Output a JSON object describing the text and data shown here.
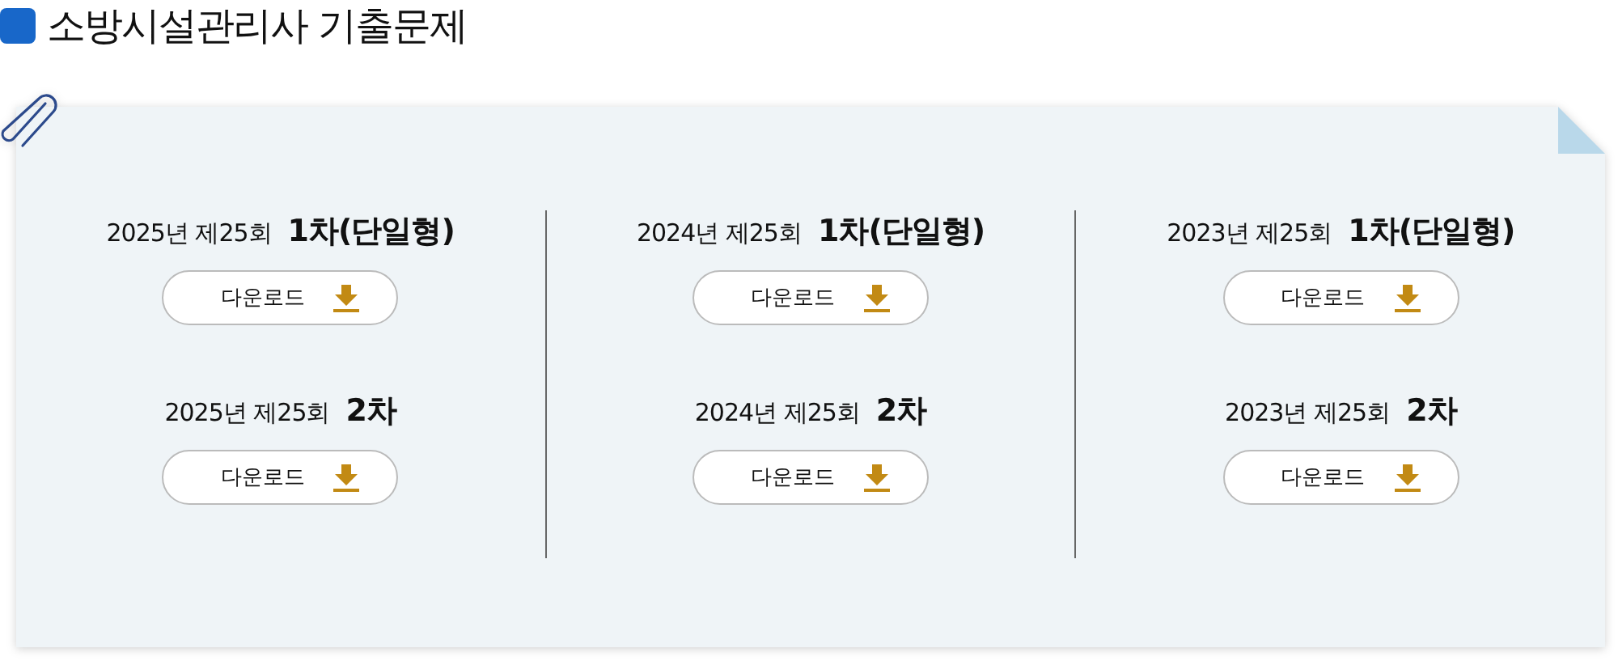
{
  "title": "소방시설관리사 기출문제",
  "columns": [
    {
      "items": [
        {
          "exam": "2025년 제25회",
          "round": "1차(단일형)",
          "button": "다운로드"
        },
        {
          "exam": "2025년 제25회",
          "round": "2차",
          "button": "다운로드"
        }
      ]
    },
    {
      "items": [
        {
          "exam": "2024년 제25회",
          "round": "1차(단일형)",
          "button": "다운로드"
        },
        {
          "exam": "2024년 제25회",
          "round": "2차",
          "button": "다운로드"
        }
      ]
    },
    {
      "items": [
        {
          "exam": "2023년 제25회",
          "round": "1차(단일형)",
          "button": "다운로드"
        },
        {
          "exam": "2023년 제25회",
          "round": "2차",
          "button": "다운로드"
        }
      ]
    }
  ]
}
